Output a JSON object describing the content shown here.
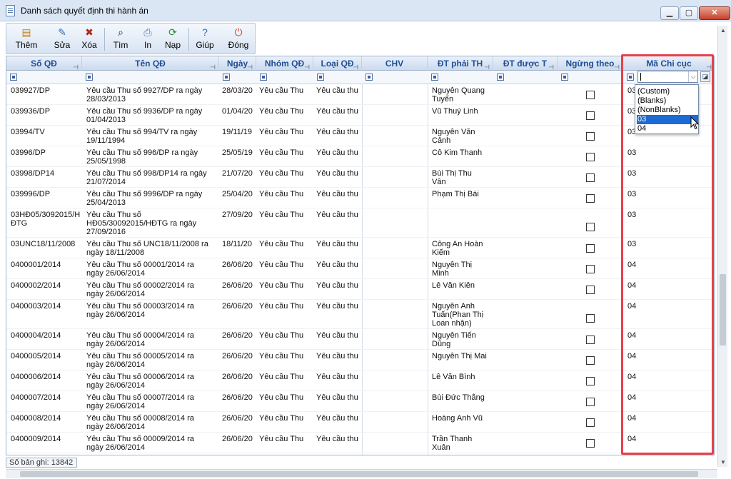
{
  "window": {
    "title": "Danh sách quyết định thi hành án",
    "minimize_glyph": "▁",
    "maximize_glyph": "▢",
    "close_glyph": "✕"
  },
  "toolbar": {
    "buttons": [
      {
        "label": "Thêm",
        "icon": "add-icon",
        "glyph": "▤"
      },
      {
        "label": "Sửa",
        "icon": "edit-icon",
        "glyph": "✎"
      },
      {
        "label": "Xóa",
        "icon": "delete-icon",
        "glyph": "✖"
      },
      {
        "label": "Tìm",
        "icon": "binoculars-icon",
        "glyph": "⌕"
      },
      {
        "label": "In",
        "icon": "print-icon",
        "glyph": "⎙"
      },
      {
        "label": "Nạp",
        "icon": "refresh-icon",
        "glyph": "⟳"
      },
      {
        "label": "Giúp",
        "icon": "help-icon",
        "glyph": "?"
      },
      {
        "label": "Đóng",
        "icon": "exit-icon",
        "glyph": "⏻"
      }
    ]
  },
  "grid": {
    "columns": [
      {
        "key": "so_qd",
        "label": "Số QĐ"
      },
      {
        "key": "ten_qd",
        "label": "Tên QĐ"
      },
      {
        "key": "ngay",
        "label": "Ngày"
      },
      {
        "key": "nhom_qd",
        "label": "Nhóm QĐ"
      },
      {
        "key": "loai_qd",
        "label": "Loại QĐ"
      },
      {
        "key": "chv",
        "label": "CHV"
      },
      {
        "key": "dt_phai_th",
        "label": "ĐT phải TH"
      },
      {
        "key": "dt_duoc_t",
        "label": "ĐT được T"
      },
      {
        "key": "ngung_theo",
        "label": "Ngừng theo"
      },
      {
        "key": "ma_chi_cuc",
        "label": "Mã Chi cục"
      }
    ],
    "pin_glyph": "⊣",
    "rows": [
      {
        "so_qd": "039927/DP",
        "ten_qd": [
          "Yêu cầu Thu số 9927/DP ra ngày",
          "28/03/2013"
        ],
        "ngay": "28/03/20",
        "nhom_qd": "Yêu cầu Thu",
        "loai_qd": "Yêu cầu thu",
        "dt_phai_th": [
          "Nguyễn Quang",
          "Tuyến"
        ],
        "ma_chi_cuc": "03"
      },
      {
        "so_qd": "039936/DP",
        "ten_qd": [
          "Yêu cầu Thu số 9936/DP ra ngày",
          "01/04/2013"
        ],
        "ngay": "01/04/20",
        "nhom_qd": "Yêu cầu Thu",
        "loai_qd": "Yêu cầu thu",
        "dt_phai_th": [
          "Vũ Thuý Linh"
        ],
        "ma_chi_cuc": "03"
      },
      {
        "so_qd": "03994/TV",
        "ten_qd": [
          "Yêu cầu Thu số 994/TV ra ngày",
          "19/11/1994"
        ],
        "ngay": "19/11/19",
        "nhom_qd": "Yêu cầu Thu",
        "loai_qd": "Yêu cầu thu",
        "dt_phai_th": [
          "Nguyễn Văn",
          "Cảnh"
        ],
        "ma_chi_cuc": "03"
      },
      {
        "so_qd": "03996/DP",
        "ten_qd": [
          "Yêu cầu Thu số 996/DP ra ngày",
          "25/05/1998"
        ],
        "ngay": "25/05/19",
        "nhom_qd": "Yêu cầu Thu",
        "loai_qd": "Yêu cầu thu",
        "dt_phai_th": [
          "Cô Kim Thanh"
        ],
        "ma_chi_cuc": "03"
      },
      {
        "so_qd": "03998/DP14",
        "ten_qd": [
          "Yêu cầu Thu số 998/DP14 ra ngày",
          "21/07/2014"
        ],
        "ngay": "21/07/20",
        "nhom_qd": "Yêu cầu Thu",
        "loai_qd": "Yêu cầu thu",
        "dt_phai_th": [
          "Bùi Thị Thu",
          "Vân"
        ],
        "ma_chi_cuc": "03"
      },
      {
        "so_qd": "039996/DP",
        "ten_qd": [
          "Yêu cầu Thu số 9996/DP ra ngày",
          "25/04/2013"
        ],
        "ngay": "25/04/20",
        "nhom_qd": "Yêu cầu Thu",
        "loai_qd": "Yêu cầu thu",
        "dt_phai_th": [
          "Phạm Thị Bái"
        ],
        "ma_chi_cuc": "03"
      },
      {
        "so_qd": [
          "03HĐ05/3092015/H",
          "ĐTG"
        ],
        "ten_qd": [
          "Yêu cầu Thu số",
          "HĐ05/30092015/HĐTG ra ngày",
          "27/09/2016"
        ],
        "ngay": "27/09/20",
        "nhom_qd": "Yêu cầu Thu",
        "loai_qd": "Yêu cầu thu",
        "dt_phai_th": [],
        "ma_chi_cuc": "03"
      },
      {
        "so_qd": "03UNC18/11/2008",
        "ten_qd": [
          "Yêu cầu Thu số UNC18/11/2008 ra",
          "ngày 18/11/2008"
        ],
        "ngay": "18/11/20",
        "nhom_qd": "Yêu cầu Thu",
        "loai_qd": "Yêu cầu thu",
        "dt_phai_th": [
          "Công An Hoàn",
          "Kiếm"
        ],
        "ma_chi_cuc": "03"
      },
      {
        "so_qd": "0400001/2014",
        "ten_qd": [
          "Yêu cầu Thu số 00001/2014 ra",
          "ngày 26/06/2014"
        ],
        "ngay": "26/06/20",
        "nhom_qd": "Yêu cầu Thu",
        "loai_qd": "Yêu cầu thu",
        "dt_phai_th": [
          "Nguyễn Thị",
          "Minh"
        ],
        "ma_chi_cuc": "04"
      },
      {
        "so_qd": "0400002/2014",
        "ten_qd": [
          "Yêu cầu Thu số 00002/2014 ra",
          "ngày 26/06/2014"
        ],
        "ngay": "26/06/20",
        "nhom_qd": "Yêu cầu Thu",
        "loai_qd": "Yêu cầu thu",
        "dt_phai_th": [
          "Lê Văn Kiên"
        ],
        "ma_chi_cuc": "04"
      },
      {
        "so_qd": "0400003/2014",
        "ten_qd": [
          "Yêu cầu Thu số 00003/2014 ra",
          "ngày 26/06/2014"
        ],
        "ngay": "26/06/20",
        "nhom_qd": "Yêu cầu Thu",
        "loai_qd": "Yêu cầu thu",
        "dt_phai_th": [
          "Nguyễn Anh",
          "Tuấn(Phan Thị",
          "Loan nhận)"
        ],
        "ma_chi_cuc": "04"
      },
      {
        "so_qd": "0400004/2014",
        "ten_qd": [
          "Yêu cầu Thu số 00004/2014 ra",
          "ngày 26/06/2014"
        ],
        "ngay": "26/06/20",
        "nhom_qd": "Yêu cầu Thu",
        "loai_qd": "Yêu cầu thu",
        "dt_phai_th": [
          "Nguyễn Tiến",
          "Dũng"
        ],
        "ma_chi_cuc": "04"
      },
      {
        "so_qd": "0400005/2014",
        "ten_qd": [
          "Yêu cầu Thu số 00005/2014 ra",
          "ngày 26/06/2014"
        ],
        "ngay": "26/06/20",
        "nhom_qd": "Yêu cầu Thu",
        "loai_qd": "Yêu cầu thu",
        "dt_phai_th": [
          "Nguyễn Thị Mai"
        ],
        "ma_chi_cuc": "04"
      },
      {
        "so_qd": "0400006/2014",
        "ten_qd": [
          "Yêu cầu Thu số 00006/2014 ra",
          "ngày 26/06/2014"
        ],
        "ngay": "26/06/20",
        "nhom_qd": "Yêu cầu Thu",
        "loai_qd": "Yêu cầu thu",
        "dt_phai_th": [
          "Lê Văn Bình"
        ],
        "ma_chi_cuc": "04"
      },
      {
        "so_qd": "0400007/2014",
        "ten_qd": [
          "Yêu cầu Thu số 00007/2014 ra",
          "ngày 26/06/2014"
        ],
        "ngay": "26/06/20",
        "nhom_qd": "Yêu cầu Thu",
        "loai_qd": "Yêu cầu thu",
        "dt_phai_th": [
          "Bùi Đức Thắng"
        ],
        "ma_chi_cuc": "04"
      },
      {
        "so_qd": "0400008/2014",
        "ten_qd": [
          "Yêu cầu Thu số 00008/2014 ra",
          "ngày 26/06/2014"
        ],
        "ngay": "26/06/20",
        "nhom_qd": "Yêu cầu Thu",
        "loai_qd": "Yêu cầu thu",
        "dt_phai_th": [
          "Hoàng Anh Vũ"
        ],
        "ma_chi_cuc": "04"
      },
      {
        "so_qd": "0400009/2014",
        "ten_qd": [
          "Yêu cầu Thu số 00009/2014 ra",
          "ngày 26/06/2014"
        ],
        "ngay": "26/06/20",
        "nhom_qd": "Yêu cầu Thu",
        "loai_qd": "Yêu cầu thu",
        "dt_phai_th": [
          "Trần Thanh",
          "Xuân"
        ],
        "ma_chi_cuc": "04"
      }
    ]
  },
  "filter_dropdown": {
    "options": [
      "(Custom)",
      "(Blanks)",
      "(NonBlanks)",
      "03",
      "04"
    ],
    "selected": "03",
    "clear_glyph": "◪",
    "arrow_glyph": "⌵"
  },
  "status": {
    "record_count": "Số bản ghi: 13842"
  },
  "scrollbar": {
    "up_glyph": "▲",
    "down_glyph": "▼"
  },
  "colors": {
    "header_text": "#1f4e96",
    "highlight": "#e8404a",
    "selection": "#1b6bd2"
  }
}
